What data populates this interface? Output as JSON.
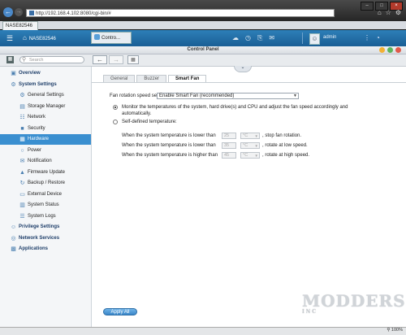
{
  "browser": {
    "url": "http://192.168.4.102:8080/cgi-bin/#",
    "tab_title": "NASE82546",
    "window_buttons": [
      "–",
      "□",
      "×"
    ]
  },
  "topbar": {
    "home_label": "NASE82546",
    "app_tab_label": "Contro...",
    "username": "admin"
  },
  "window": {
    "title": "Control Panel"
  },
  "toolbar": {
    "search_placeholder": "Search"
  },
  "sidebar": {
    "items": [
      {
        "label": "Overview",
        "type": "category",
        "icon": "overview-icon"
      },
      {
        "label": "System Settings",
        "type": "category",
        "icon": "gear-icon"
      },
      {
        "label": "General Settings",
        "type": "item",
        "icon": "general-settings-icon"
      },
      {
        "label": "Storage Manager",
        "type": "item",
        "icon": "storage-icon"
      },
      {
        "label": "Network",
        "type": "item",
        "icon": "network-icon"
      },
      {
        "label": "Security",
        "type": "item",
        "icon": "lock-icon"
      },
      {
        "label": "Hardware",
        "type": "item",
        "icon": "hardware-icon",
        "selected": true
      },
      {
        "label": "Power",
        "type": "item",
        "icon": "power-icon"
      },
      {
        "label": "Notification",
        "type": "item",
        "icon": "notification-icon"
      },
      {
        "label": "Firmware Update",
        "type": "item",
        "icon": "firmware-icon"
      },
      {
        "label": "Backup / Restore",
        "type": "item",
        "icon": "backup-icon"
      },
      {
        "label": "External Device",
        "type": "item",
        "icon": "external-device-icon"
      },
      {
        "label": "System Status",
        "type": "item",
        "icon": "status-icon"
      },
      {
        "label": "System Logs",
        "type": "item",
        "icon": "logs-icon"
      },
      {
        "label": "Privilege Settings",
        "type": "category",
        "icon": "privilege-icon"
      },
      {
        "label": "Network Services",
        "type": "category",
        "icon": "globe-icon"
      },
      {
        "label": "Applications",
        "type": "category",
        "icon": "applications-icon"
      }
    ]
  },
  "content": {
    "tabs": [
      "General",
      "Buzzer",
      "Smart Fan"
    ],
    "active_tab": "Smart Fan",
    "fan_label": "Fan rotation speed settings:",
    "fan_value": "Enable Smart Fan (recommended)",
    "option_smart": "Monitor the temperatures of the system, hard drive(s) and CPU and adjust the fan speed accordingly and",
    "option_smart_cont": "automatically.",
    "option_custom": "Self-defined temperature:",
    "rows": [
      {
        "prefix": "When the system temperature is lower than",
        "value": "25",
        "unit": "°C",
        "suffix": ", stop fan rotation."
      },
      {
        "prefix": "When the system temperature is lower than",
        "value": "35",
        "unit": "°C",
        "suffix": ", rotate at low speed."
      },
      {
        "prefix": "When the system temperature is higher than",
        "value": "45",
        "unit": "°C",
        "suffix": ", rotate at high speed."
      }
    ],
    "apply_label": "Apply All"
  },
  "watermark": {
    "main": "MODDERS",
    "sub": "INC"
  },
  "statusbar": {
    "zoom": "100%"
  },
  "colors": {
    "accent": "#3a8fd0",
    "topbar": "#1f6ba3",
    "close_button": "#e05a4a",
    "minimize_button": "#f2b134",
    "maximize_button": "#5bb55a"
  }
}
